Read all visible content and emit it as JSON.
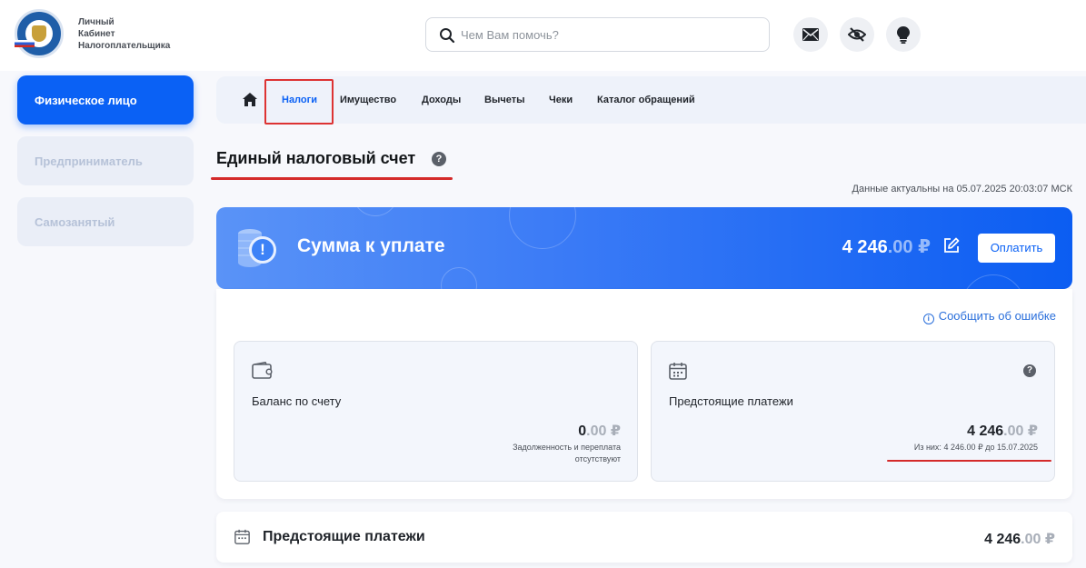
{
  "header": {
    "brand_lines": [
      "Личный",
      "Кабинет",
      "Налогоплательщика"
    ],
    "search_placeholder": "Чем Вам помочь?",
    "icons": [
      "mail-icon",
      "eye-off-icon",
      "lightbulb-icon"
    ]
  },
  "sidebar": {
    "items": [
      {
        "label": "Физическое лицо",
        "active": true
      },
      {
        "label": "Предприниматель",
        "active": false
      },
      {
        "label": "Самозанятый",
        "active": false
      }
    ]
  },
  "nav": {
    "items": [
      {
        "label": "Налоги",
        "active": true
      },
      {
        "label": "Имущество"
      },
      {
        "label": "Доходы"
      },
      {
        "label": "Вычеты"
      },
      {
        "label": "Чеки"
      },
      {
        "label": "Каталог обращений"
      }
    ]
  },
  "page": {
    "title": "Единый налоговый счет",
    "help_glyph": "?",
    "actual_date": "Данные актуальны на 05.07.2025 20:03:07 МСК"
  },
  "banner": {
    "exclamation": "!",
    "label": "Сумма к уплате",
    "amount_int": "4 246",
    "amount_dec": ".00 ₽",
    "pay_label": "Оплатить",
    "accent_color": "#0a61f5"
  },
  "card": {
    "report_label": "Сообщить об ошибке",
    "balance": {
      "label": "Баланс по счету",
      "amount_int": "0",
      "amount_dec": ".00 ₽",
      "note_line1": "Задолженность и переплата",
      "note_line2": "отсутствуют"
    },
    "upcoming": {
      "label": "Предстоящие платежи",
      "amount_int": "4 246",
      "amount_dec": ".00 ₽",
      "note": "Из них: 4 246.00 ₽ до 15.07.2025"
    }
  },
  "bottom": {
    "label": "Предстоящие платежи",
    "amount_int": "4 246",
    "amount_dec": ".00 ₽"
  }
}
